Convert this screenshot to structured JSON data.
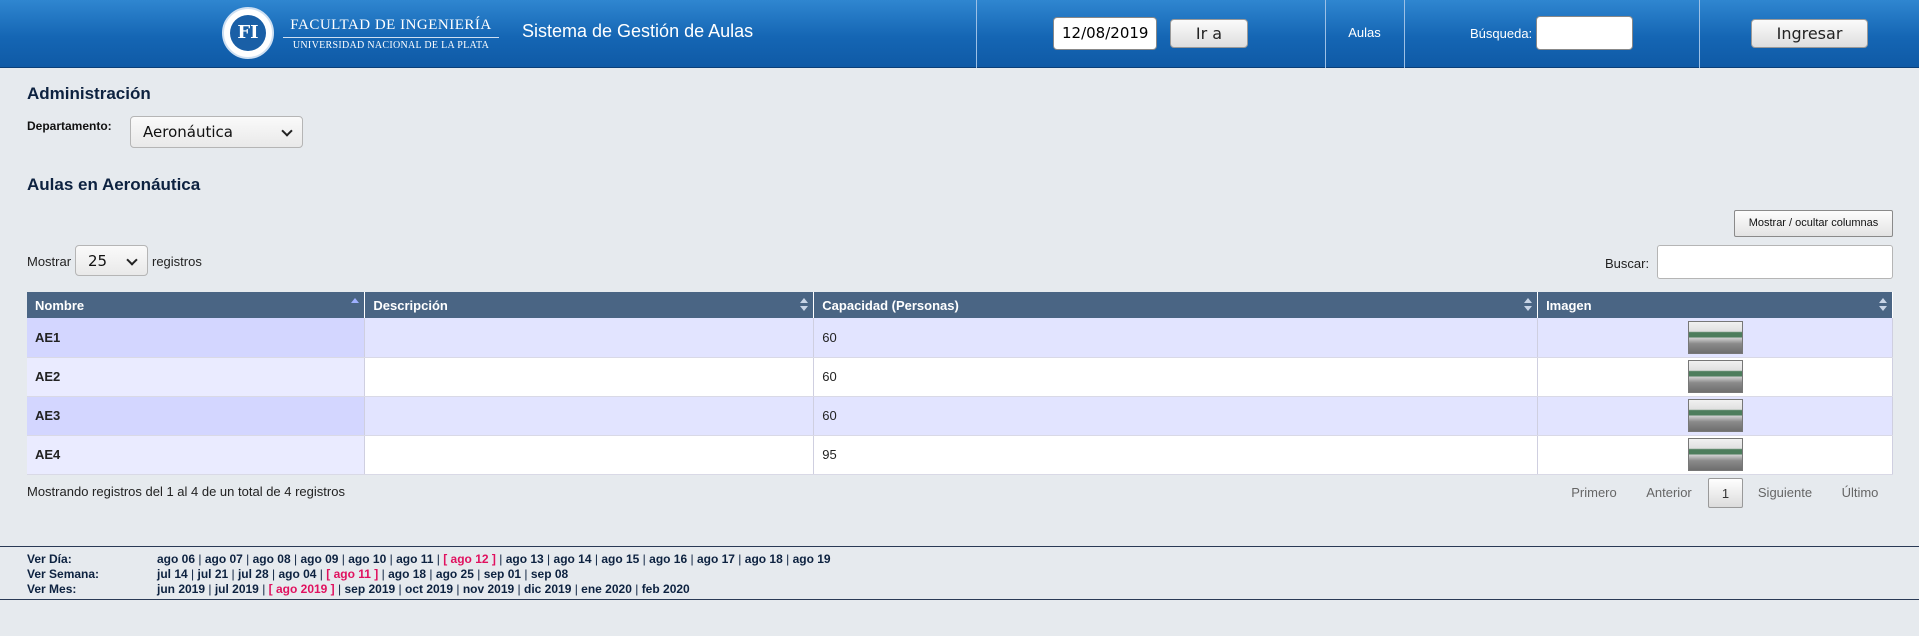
{
  "header": {
    "logo_text": "FI",
    "faculty_name": "FACULTAD DE INGENIERÍA",
    "university_name": "UNIVERSIDAD NACIONAL DE LA PLATA",
    "system_title": "Sistema de Gestión de Aulas",
    "date_value": "12/08/2019",
    "go_button": "Ir a",
    "nav_aulas": "Aulas",
    "search_label": "Búsqueda:",
    "search_value": "",
    "login_button": "Ingresar"
  },
  "admin": {
    "title": "Administración",
    "department_label": "Departamento:",
    "department_selected": "Aeronáutica"
  },
  "section": {
    "title": "Aulas en Aeronáutica",
    "toggle_columns_button": "Mostrar / ocultar columnas",
    "show_label": "Mostrar",
    "page_length": "25",
    "records_label": "registros",
    "search_label": "Buscar:",
    "search_value": ""
  },
  "table": {
    "columns": [
      "Nombre",
      "Descripción",
      "Capacidad (Personas)",
      "Imagen"
    ],
    "rows": [
      {
        "name": "AE1",
        "description": "",
        "capacity": "60",
        "image": "classroom-photo"
      },
      {
        "name": "AE2",
        "description": "",
        "capacity": "60",
        "image": "classroom-photo"
      },
      {
        "name": "AE3",
        "description": "",
        "capacity": "60",
        "image": "classroom-photo"
      },
      {
        "name": "AE4",
        "description": "",
        "capacity": "95",
        "image": "classroom-photo"
      }
    ],
    "info": "Mostrando registros del 1 al 4 de un total de 4 registros"
  },
  "pagination": {
    "first": "Primero",
    "previous": "Anterior",
    "current": "1",
    "next": "Siguiente",
    "last": "Último"
  },
  "footer": {
    "day_label": "Ver Día:",
    "days": [
      "ago 06",
      "ago 07",
      "ago 08",
      "ago 09",
      "ago 10",
      "ago 11",
      "[ ago 12 ]",
      "ago 13",
      "ago 14",
      "ago 15",
      "ago 16",
      "ago 17",
      "ago 18",
      "ago 19"
    ],
    "day_current_index": 6,
    "week_label": "Ver Semana:",
    "weeks": [
      "jul 14",
      "jul 21",
      "jul 28",
      "ago 04",
      "[ ago 11 ]",
      "ago 18",
      "ago 25",
      "sep 01",
      "sep 08"
    ],
    "week_current_index": 4,
    "month_label": "Ver Mes:",
    "months": [
      "jun 2019",
      "jul 2019",
      "[ ago 2019 ]",
      "sep 2019",
      "oct 2019",
      "nov 2019",
      "dic 2019",
      "ene 2020",
      "feb 2020"
    ],
    "month_current_index": 2
  },
  "colors": {
    "header_blue": "#1566b4",
    "table_header": "#4a6584",
    "row_odd": "#e2e4ff",
    "current_link": "#e0115f"
  }
}
